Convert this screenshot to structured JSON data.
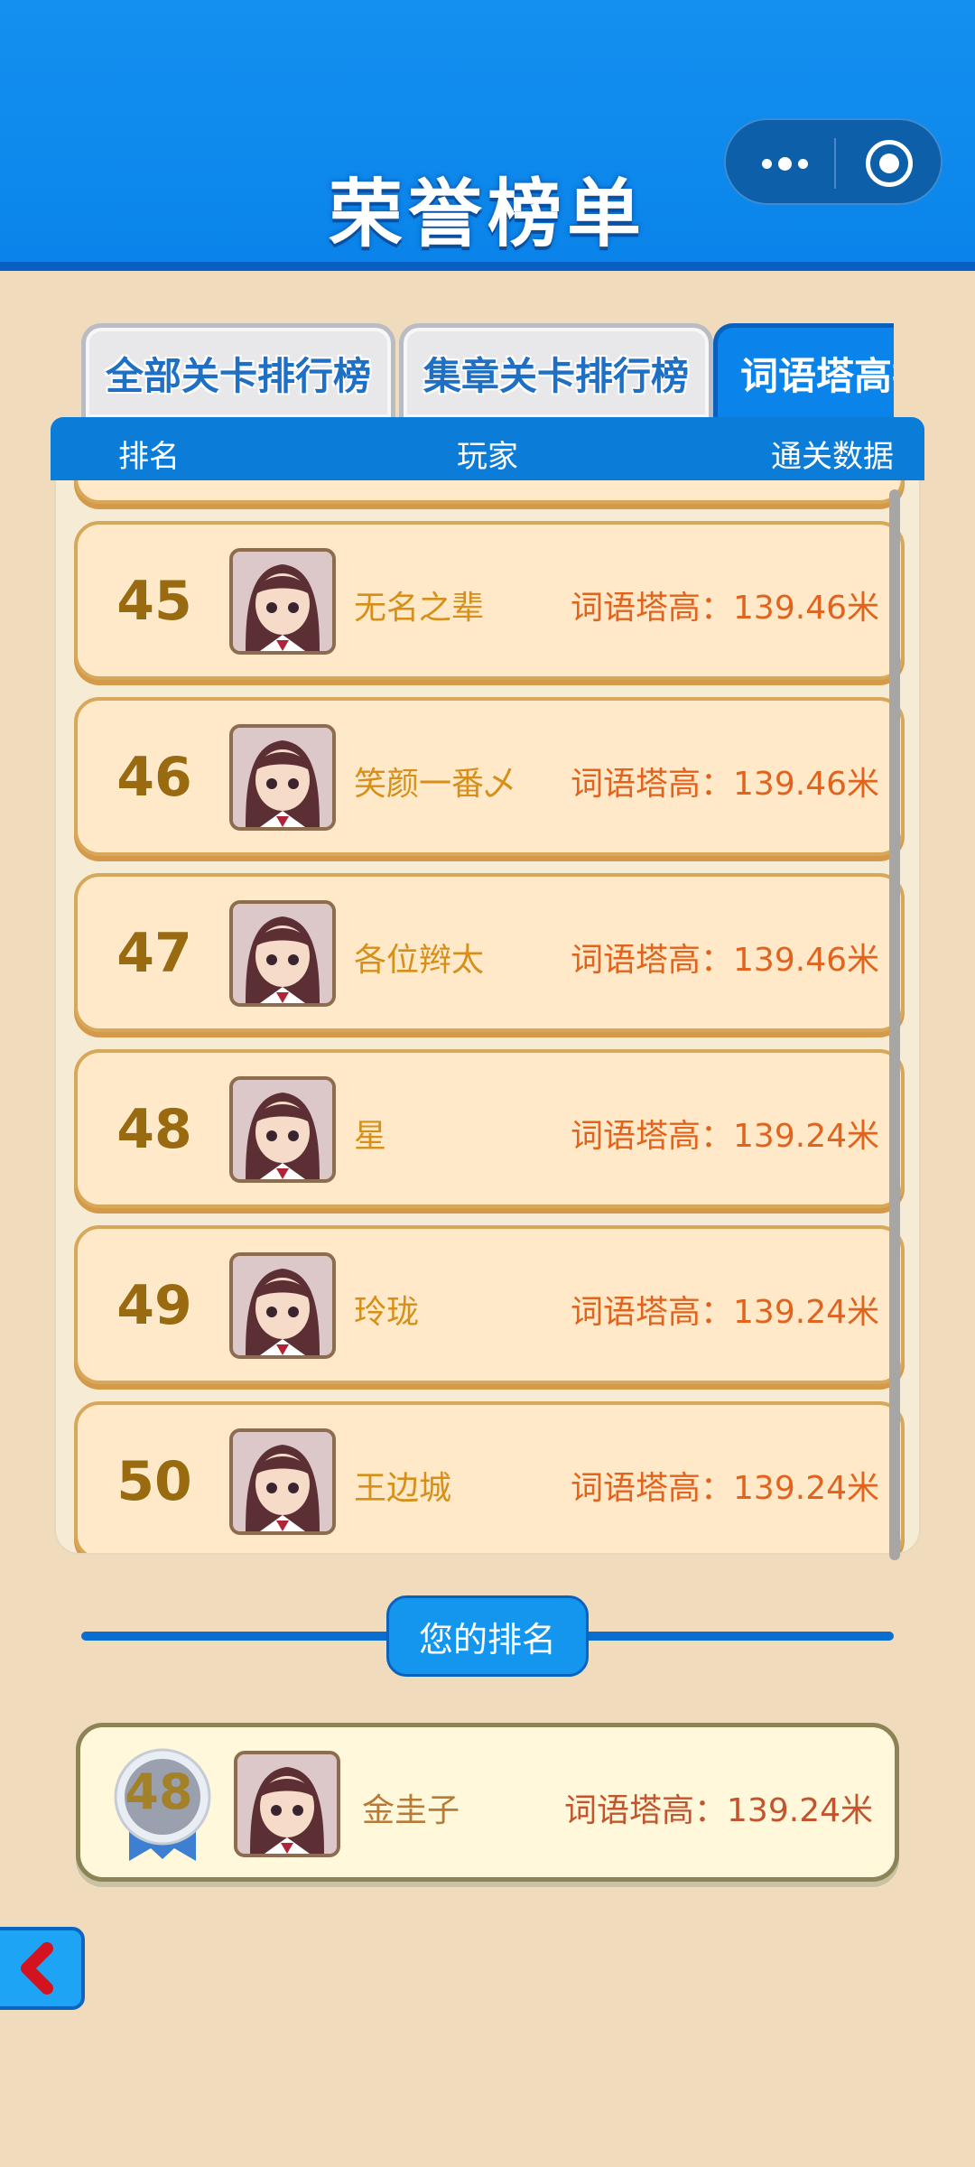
{
  "header": {
    "title": "荣誉榜单"
  },
  "tabs": [
    {
      "label": "全部关卡排行榜",
      "active": false
    },
    {
      "label": "集章关卡排行榜",
      "active": false
    },
    {
      "label": "词语塔高排行榜",
      "active": true
    }
  ],
  "columns": {
    "rank": "排名",
    "player": "玩家",
    "data": "通关数据"
  },
  "rows": [
    {
      "rank": "45",
      "name": "无名之辈",
      "score_label": "词语塔高：",
      "score_value": "139.46米"
    },
    {
      "rank": "46",
      "name": "笑颜一番乄",
      "score_label": "词语塔高：",
      "score_value": "139.46米"
    },
    {
      "rank": "47",
      "name": "各位辫太",
      "score_label": "词语塔高：",
      "score_value": "139.46米"
    },
    {
      "rank": "48",
      "name": "星",
      "score_label": "词语塔高：",
      "score_value": "139.24米"
    },
    {
      "rank": "49",
      "name": "玲珑",
      "score_label": "词语塔高：",
      "score_value": "139.24米"
    },
    {
      "rank": "50",
      "name": "王边城",
      "score_label": "词语塔高：",
      "score_value": "139.24米"
    }
  ],
  "your_rank": {
    "label": "您的排名",
    "rank": "48",
    "name": "金圭子",
    "score_label": "词语塔高：",
    "score_value": "139.24米"
  },
  "colors": {
    "header_blue": "#0a84ea",
    "row_bg": "#ffe9c8",
    "score_text": "#e0631e",
    "name_text": "#d6901a"
  },
  "icons": {
    "capsule_more": "more-dots-icon",
    "capsule_close": "target-circle-icon",
    "back": "chevron-left-icon",
    "medal": "medal-ribbon-icon"
  }
}
